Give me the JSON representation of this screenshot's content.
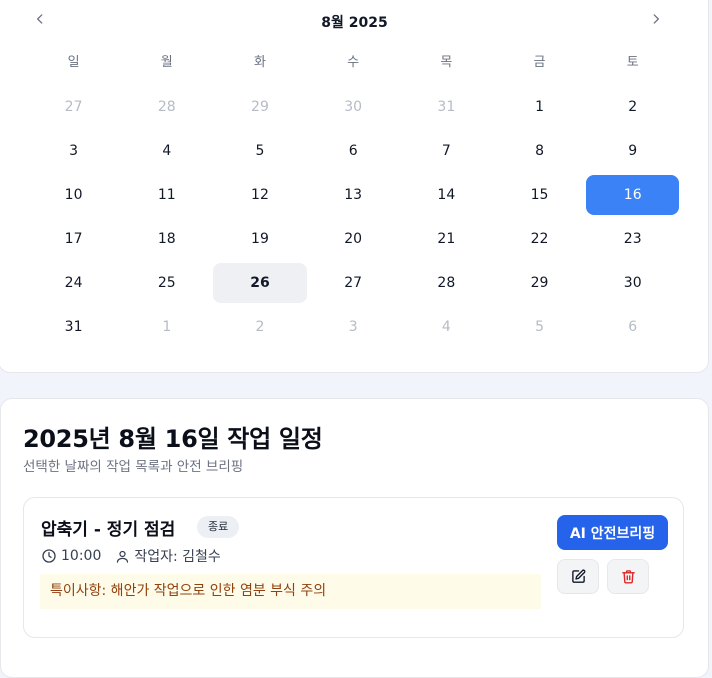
{
  "calendar": {
    "month_label": "8월 2025",
    "prev_icon": "chevron-left-icon",
    "next_icon": "chevron-right-icon",
    "weekdays": [
      "일",
      "월",
      "화",
      "수",
      "목",
      "금",
      "토"
    ],
    "days": [
      {
        "label": "27",
        "state": "outside"
      },
      {
        "label": "28",
        "state": "outside"
      },
      {
        "label": "29",
        "state": "outside"
      },
      {
        "label": "30",
        "state": "outside"
      },
      {
        "label": "31",
        "state": "outside"
      },
      {
        "label": "1",
        "state": "current"
      },
      {
        "label": "2",
        "state": "current"
      },
      {
        "label": "3",
        "state": "current"
      },
      {
        "label": "4",
        "state": "current"
      },
      {
        "label": "5",
        "state": "current"
      },
      {
        "label": "6",
        "state": "current"
      },
      {
        "label": "7",
        "state": "current"
      },
      {
        "label": "8",
        "state": "current"
      },
      {
        "label": "9",
        "state": "current"
      },
      {
        "label": "10",
        "state": "current"
      },
      {
        "label": "11",
        "state": "current"
      },
      {
        "label": "12",
        "state": "current"
      },
      {
        "label": "13",
        "state": "current"
      },
      {
        "label": "14",
        "state": "current"
      },
      {
        "label": "15",
        "state": "current"
      },
      {
        "label": "16",
        "state": "selected"
      },
      {
        "label": "17",
        "state": "current"
      },
      {
        "label": "18",
        "state": "current"
      },
      {
        "label": "19",
        "state": "current"
      },
      {
        "label": "20",
        "state": "current"
      },
      {
        "label": "21",
        "state": "current"
      },
      {
        "label": "22",
        "state": "current"
      },
      {
        "label": "23",
        "state": "current"
      },
      {
        "label": "24",
        "state": "current"
      },
      {
        "label": "25",
        "state": "current"
      },
      {
        "label": "26",
        "state": "today"
      },
      {
        "label": "27",
        "state": "current"
      },
      {
        "label": "28",
        "state": "current"
      },
      {
        "label": "29",
        "state": "current"
      },
      {
        "label": "30",
        "state": "current"
      },
      {
        "label": "31",
        "state": "current"
      },
      {
        "label": "1",
        "state": "outside"
      },
      {
        "label": "2",
        "state": "outside"
      },
      {
        "label": "3",
        "state": "outside"
      },
      {
        "label": "4",
        "state": "outside"
      },
      {
        "label": "5",
        "state": "outside"
      },
      {
        "label": "6",
        "state": "outside"
      }
    ]
  },
  "schedule": {
    "title": "2025년 8월 16일 작업 일정",
    "subtitle": "선택한 날짜의 작업 목록과 안전 브리핑",
    "tasks": [
      {
        "title": "압축기 - 정기 점검",
        "status": "종료",
        "time": "10:00",
        "worker": "작업자: 김철수",
        "note": "특이사항: 해안가 작업으로 인한 염분 부식 주의",
        "ai_button": "AI 안전브리핑",
        "time_icon": "clock-icon",
        "worker_icon": "user-icon",
        "edit_icon": "edit-icon",
        "delete_icon": "trash-icon"
      }
    ]
  },
  "colors": {
    "accent": "#3b82f6",
    "primary_button": "#2563eb",
    "today_bg": "#eef0f4",
    "note_bg": "#fefbe8",
    "note_text": "#92400e",
    "delete": "#dc2626"
  }
}
